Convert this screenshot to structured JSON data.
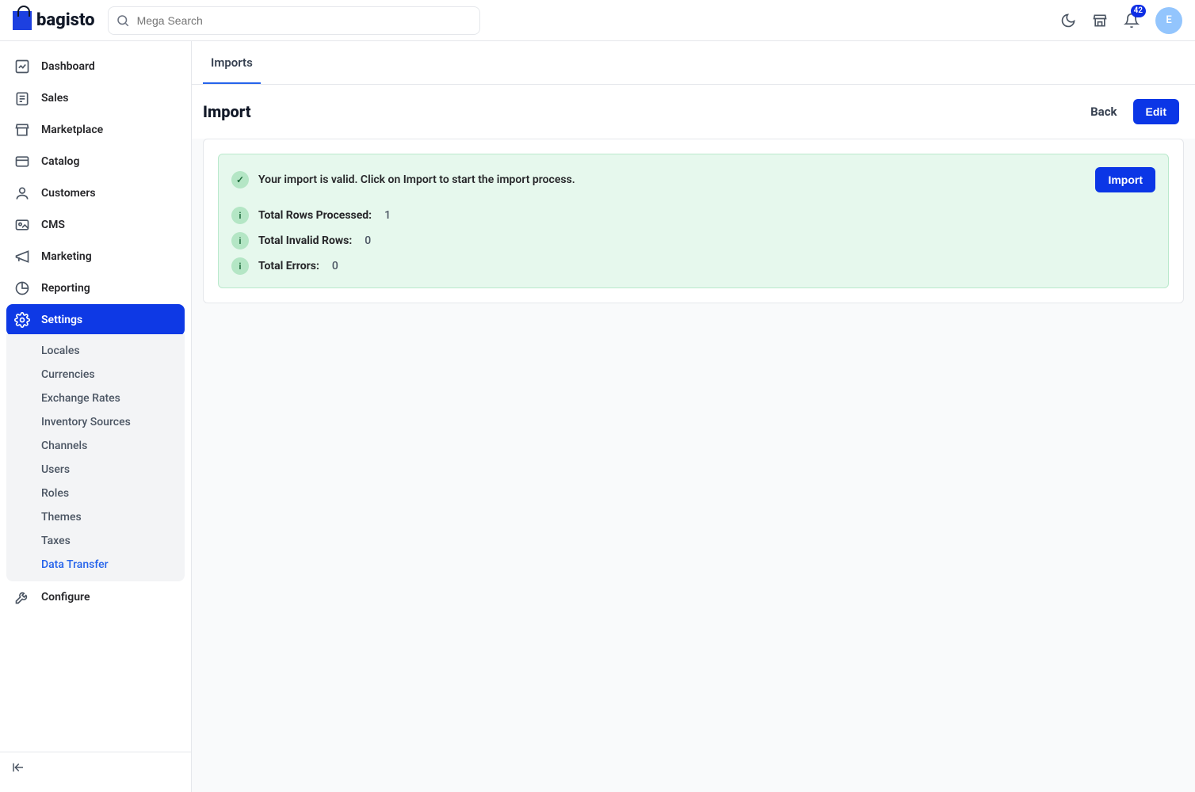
{
  "header": {
    "brand": "bagisto",
    "search_placeholder": "Mega Search",
    "notification_count": "42",
    "avatar_initial": "E"
  },
  "sidebar": {
    "items": [
      {
        "label": "Dashboard"
      },
      {
        "label": "Sales"
      },
      {
        "label": "Marketplace"
      },
      {
        "label": "Catalog"
      },
      {
        "label": "Customers"
      },
      {
        "label": "CMS"
      },
      {
        "label": "Marketing"
      },
      {
        "label": "Reporting"
      },
      {
        "label": "Settings"
      },
      {
        "label": "Configure"
      }
    ],
    "settings_sub": [
      {
        "label": "Locales"
      },
      {
        "label": "Currencies"
      },
      {
        "label": "Exchange Rates"
      },
      {
        "label": "Inventory Sources"
      },
      {
        "label": "Channels"
      },
      {
        "label": "Users"
      },
      {
        "label": "Roles"
      },
      {
        "label": "Themes"
      },
      {
        "label": "Taxes"
      },
      {
        "label": "Data Transfer"
      }
    ]
  },
  "tabs": {
    "imports": "Imports"
  },
  "page": {
    "title": "Import",
    "back": "Back",
    "edit": "Edit"
  },
  "alert": {
    "message": "Your import is valid. Click on Import to start the import process.",
    "action": "Import",
    "rows_processed_label": "Total Rows Processed:",
    "rows_processed_value": "1",
    "invalid_rows_label": "Total Invalid Rows:",
    "invalid_rows_value": "0",
    "errors_label": "Total Errors:",
    "errors_value": "0"
  }
}
